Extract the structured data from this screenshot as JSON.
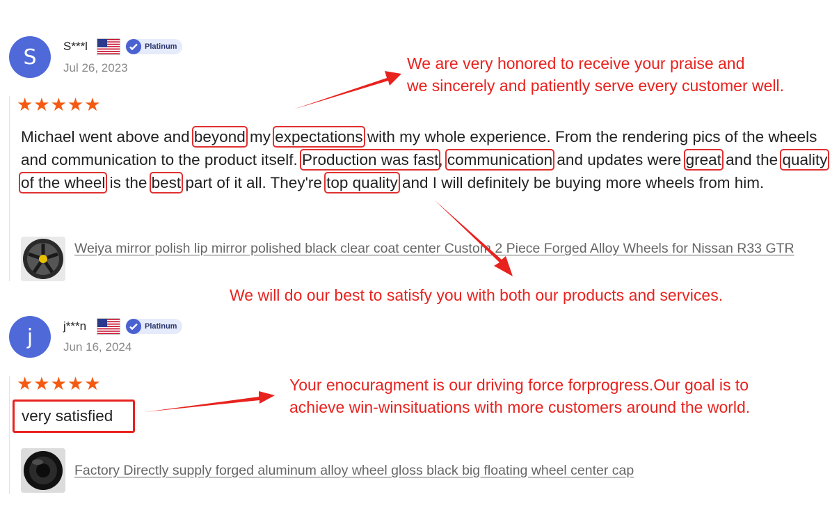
{
  "reviews": [
    {
      "avatar_letter": "S",
      "username": "S***l",
      "badge": "Platinum",
      "date": "Jul 26, 2023",
      "stars": "★★★★★",
      "rating": 5,
      "text_segments": [
        {
          "t": "Michael went above and ",
          "hl": false
        },
        {
          "t": "beyond",
          "hl": true
        },
        {
          "t": " my ",
          "hl": false
        },
        {
          "t": "expectations",
          "hl": true
        },
        {
          "t": " with my whole experience. From the rendering pics of the wheels and communication to the product itself. ",
          "hl": false
        },
        {
          "t": "Production was fast",
          "hl": true
        },
        {
          "t": ", ",
          "hl": false
        },
        {
          "t": "communication",
          "hl": true
        },
        {
          "t": " and updates were ",
          "hl": false
        },
        {
          "t": "great",
          "hl": true
        },
        {
          "t": " and the ",
          "hl": false
        },
        {
          "t": "quality of the wheel",
          "hl": true
        },
        {
          "t": " is the ",
          "hl": false
        },
        {
          "t": "best",
          "hl": true
        },
        {
          "t": " part of it all. They're ",
          "hl": false
        },
        {
          "t": "top quality",
          "hl": true
        },
        {
          "t": " and I will definitely be buying more wheels from him.",
          "hl": false
        }
      ],
      "product": "Weiya mirror polish lip mirror polished black clear coat center Custom 2 Piece Forged Alloy Wheels for Nissan R33 GTR"
    },
    {
      "avatar_letter": "j",
      "username": "j***n",
      "badge": "Platinum",
      "date": "Jun 16, 2024",
      "stars": "★★★★★",
      "rating": 5,
      "text": "very satisfied",
      "product": "Factory Directly supply forged aluminum alloy wheel gloss black big floating wheel center cap"
    }
  ],
  "annotations": {
    "a1_line1": "We are very honored to receive your praise and",
    "a1_line2": "we sincerely and patiently serve every customer well.",
    "a2": "We will do our best to satisfy you with both our products and services.",
    "a3_line1": "Your enocuragment is our driving force forprogress.Our goal is to",
    "a3_line2": "achieve win-winsituations with more customers around the world."
  },
  "colors": {
    "avatar": "#4f69d9",
    "star": "#f45a12",
    "annotation": "#e8221e",
    "badge_bg": "#e6ebfb"
  },
  "icons": [
    "us-flag-icon",
    "platinum-shield-icon",
    "star-icon",
    "arrow-icon"
  ]
}
